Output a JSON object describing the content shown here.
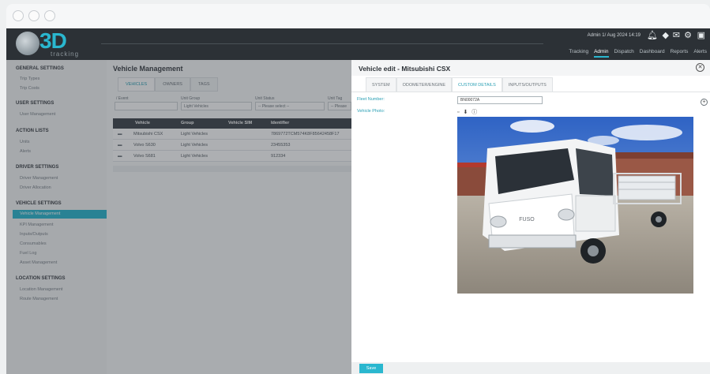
{
  "header": {
    "logo_text": "3D",
    "logo_subtext": "tracking",
    "admin_label": "Admin  1/ Aug 2024 14:19",
    "nav": [
      "Tracking",
      "Admin",
      "Dispatch",
      "Dashboard",
      "Reports",
      "Alerts"
    ],
    "active_nav": "Admin"
  },
  "sidebar": {
    "sections": [
      {
        "title": "GENERAL SETTINGS",
        "items": [
          "Trip Types",
          "Trip Costs"
        ]
      },
      {
        "title": "USER SETTINGS",
        "items": [
          "User Management"
        ]
      },
      {
        "title": "ACTION LISTS",
        "items": [
          "Units",
          "Alerts"
        ]
      },
      {
        "title": "DRIVER SETTINGS",
        "items": [
          "Driver Management",
          "Driver Allocation"
        ]
      },
      {
        "title": "VEHICLE SETTINGS",
        "items": [
          "Vehicle Management",
          "KPI Management",
          "Inputs/Outputs",
          "Consumables",
          "Fuel Log",
          "Asset Management"
        ]
      },
      {
        "title": "LOCATION SETTINGS",
        "items": [
          "Location Management",
          "Route Management"
        ]
      }
    ],
    "active_item": "Vehicle Management"
  },
  "vehicle_management": {
    "title": "Vehicle Management",
    "tabs": [
      "VEHICLES",
      "OWNERS",
      "TAGS"
    ],
    "filters": {
      "search_label": "/ Event",
      "group_label": "Unit Group",
      "group_value": "Light Vehicles",
      "status_label": "Unit Status",
      "status_value": "-- Please select --",
      "tag_label": "Unit Tag",
      "tag_value": "-- Please"
    },
    "columns": [
      "Vehicle",
      "Group",
      "Vehicle SIM",
      "Identifier"
    ],
    "rows": [
      {
        "vehicle": "Mitsubishi CSX",
        "group": "Light Vehicles",
        "sim": "",
        "identifier": "7869772TCM574K8F85642458F17"
      },
      {
        "vehicle": "Volvo S630",
        "group": "Light Vehicles",
        "sim": "",
        "identifier": "23455353"
      },
      {
        "vehicle": "Volvo S681",
        "group": "Light Vehicles",
        "sim": "",
        "identifier": "912334"
      }
    ]
  },
  "edit_panel": {
    "title": "Vehicle edit - Mitsubishi CSX",
    "tabs": [
      "SYSTEM",
      "ODOMETER/ENGINE",
      "CUSTOM DETAILS",
      "INPUTS/OUTPUTS"
    ],
    "active_tab": "CUSTOM DETAILS",
    "fleet_number_label": "Fleet Number:",
    "fleet_number_value": "BN00072A",
    "vehicle_photo_label": "Vehicle Photo:",
    "truck_badge": "FUSO",
    "save_label": "Save"
  },
  "colors": {
    "accent": "#2ab7cf",
    "header_bg": "#2c3136",
    "sidebar_bg": "#f4f5f6"
  },
  "icons": {
    "header": [
      "bell-icon",
      "tag-icon",
      "mail-icon",
      "gear-icon",
      "logout-icon"
    ],
    "panel": [
      "close-icon",
      "plus-circle-icon",
      "download-icon",
      "info-icon"
    ]
  }
}
